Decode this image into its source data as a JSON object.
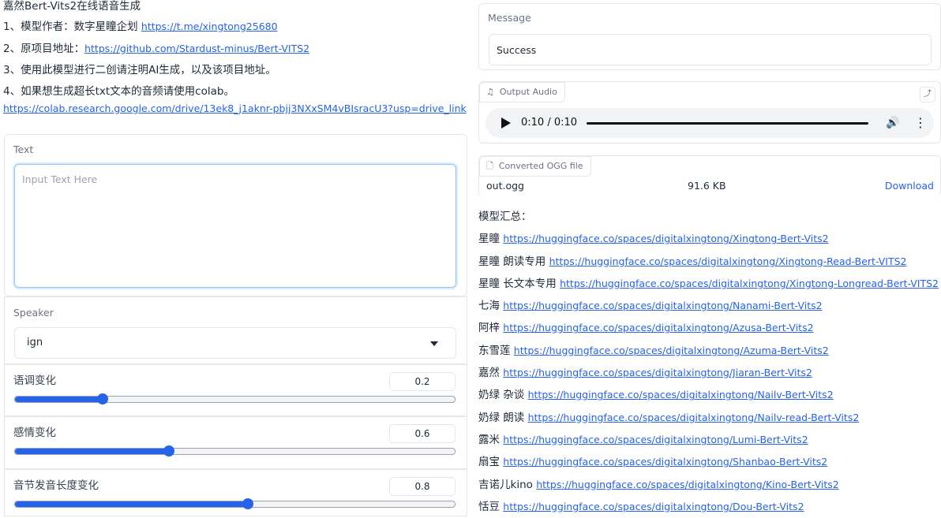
{
  "intro": {
    "title": "嘉然Bert-Vits2在线语音生成",
    "lines": [
      {
        "text": "1、模型作者：数字星瞳企划 ",
        "link": "https://t.me/xingtong25680"
      },
      {
        "text": "2、原项目地址：",
        "link": "https://github.com/Stardust-minus/Bert-VITS2"
      },
      {
        "text": "3、使用此模型进行二创请注明AI生成，以及该项目地址。",
        "link": ""
      },
      {
        "text": "4、如果想生成超长txt文本的音频请使用colab。",
        "link": ""
      }
    ],
    "colab_link": "https://colab.research.google.com/drive/13ek8_j1aknr-pbjj3NXxSM4vBIsracU3?usp=drive_link"
  },
  "text_panel": {
    "label": "Text",
    "placeholder": "Input Text Here"
  },
  "speaker": {
    "label": "Speaker",
    "value": "ign"
  },
  "sliders": [
    {
      "label": "语调变化",
      "value": "0.2",
      "fraction": 0.2
    },
    {
      "label": "感情变化",
      "value": "0.6",
      "fraction": 0.35
    },
    {
      "label": "音节发音长度变化",
      "value": "0.8",
      "fraction": 0.53
    }
  ],
  "message": {
    "label": "Message",
    "value": "Success"
  },
  "output_audio": {
    "label": "Output Audio",
    "time": "0:10 / 0:10"
  },
  "converted_file": {
    "label": "Converted OGG file",
    "name": "out.ogg",
    "size": "91.6 KB",
    "download": "Download"
  },
  "models": {
    "heading": "模型汇总：",
    "items": [
      {
        "name": "星瞳 ",
        "link": "https://huggingface.co/spaces/digitalxingtong/Xingtong-Bert-Vits2"
      },
      {
        "name": "星瞳 朗读专用 ",
        "link": "https://huggingface.co/spaces/digitalxingtong/Xingtong-Read-Bert-VITS2"
      },
      {
        "name": "星瞳 长文本专用 ",
        "link": "https://huggingface.co/spaces/digitalxingtong/Xingtong-Longread-Bert-VITS2"
      },
      {
        "name": "七海 ",
        "link": "https://huggingface.co/spaces/digitalxingtong/Nanami-Bert-Vits2"
      },
      {
        "name": "阿梓 ",
        "link": "https://huggingface.co/spaces/digitalxingtong/Azusa-Bert-Vits2"
      },
      {
        "name": "东雪莲 ",
        "link": "https://huggingface.co/spaces/digitalxingtong/Azuma-Bert-Vits2"
      },
      {
        "name": "嘉然 ",
        "link": "https://huggingface.co/spaces/digitalxingtong/Jiaran-Bert-Vits2"
      },
      {
        "name": "奶绿 杂谈 ",
        "link": "https://huggingface.co/spaces/digitalxingtong/Nailv-Bert-Vits2"
      },
      {
        "name": "奶绿 朗读 ",
        "link": "https://huggingface.co/spaces/digitalxingtong/Nailv-read-Bert-Vits2"
      },
      {
        "name": "露米 ",
        "link": "https://huggingface.co/spaces/digitalxingtong/Lumi-Bert-Vits2"
      },
      {
        "name": "扇宝 ",
        "link": "https://huggingface.co/spaces/digitalxingtong/Shanbao-Bert-Vits2"
      },
      {
        "name": "吉诺儿kino ",
        "link": "https://huggingface.co/spaces/digitalxingtong/Kino-Bert-Vits2"
      },
      {
        "name": "恬豆 ",
        "link": "https://huggingface.co/spaces/digitalxingtong/Dou-Bert-Vits2"
      }
    ]
  },
  "icons": {
    "music": "music-note-icon",
    "file": "file-icon",
    "share": "share-icon"
  }
}
